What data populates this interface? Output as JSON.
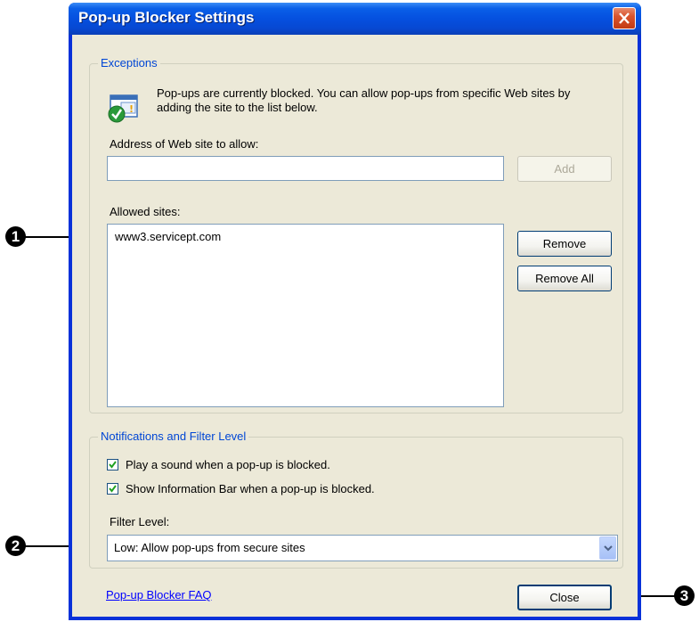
{
  "window": {
    "title": "Pop-up Blocker Settings"
  },
  "exceptions": {
    "legend": "Exceptions",
    "info_text": "Pop-ups are currently blocked.  You can allow pop-ups from specific Web sites by adding the site to the list below.",
    "address_label": "Address of Web site to allow:",
    "address_value": "",
    "add_button": "Add",
    "allowed_label": "Allowed sites:",
    "allowed_sites": [
      "www3.servicept.com"
    ],
    "remove_button": "Remove",
    "remove_all_button": "Remove All"
  },
  "notifications": {
    "legend": "Notifications and Filter Level",
    "play_sound_label": "Play a sound when a pop-up is blocked.",
    "play_sound_checked": true,
    "info_bar_label": "Show Information Bar when a pop-up is blocked.",
    "info_bar_checked": true,
    "filter_label": "Filter Level:",
    "filter_value": "Low: Allow pop-ups from secure sites"
  },
  "footer": {
    "faq_link": "Pop-up Blocker FAQ",
    "close_button": "Close"
  },
  "callouts": [
    "1",
    "2",
    "3"
  ]
}
